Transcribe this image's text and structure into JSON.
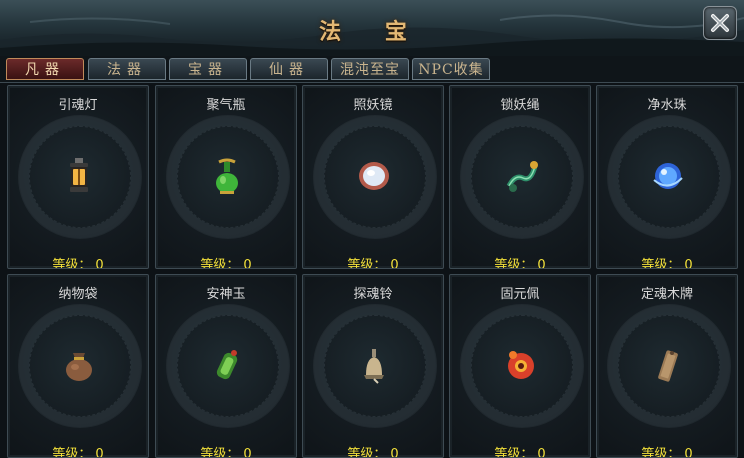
{
  "window": {
    "title": "法 宝"
  },
  "tabs": [
    {
      "label": "凡器",
      "active": true
    },
    {
      "label": "法器",
      "active": false
    },
    {
      "label": "宝器",
      "active": false
    },
    {
      "label": "仙器",
      "active": false
    },
    {
      "label": "混沌至宝",
      "active": false
    },
    {
      "label": "NPC收集",
      "active": false
    }
  ],
  "items": [
    {
      "name": "引魂灯",
      "level_label": "等级：",
      "level": "0",
      "icon": "lantern-icon"
    },
    {
      "name": "聚气瓶",
      "level_label": "等级：",
      "level": "0",
      "icon": "bottle-icon"
    },
    {
      "name": "照妖镜",
      "level_label": "等级：",
      "level": "0",
      "icon": "mirror-icon"
    },
    {
      "name": "锁妖绳",
      "level_label": "等级：",
      "level": "0",
      "icon": "rope-icon"
    },
    {
      "name": "净水珠",
      "level_label": "等级：",
      "level": "0",
      "icon": "water-pearl-icon"
    },
    {
      "name": "纳物袋",
      "level_label": "等级：",
      "level": "0",
      "icon": "pouch-icon"
    },
    {
      "name": "安神玉",
      "level_label": "等级：",
      "level": "0",
      "icon": "jade-icon"
    },
    {
      "name": "探魂铃",
      "level_label": "等级：",
      "level": "0",
      "icon": "bell-icon"
    },
    {
      "name": "固元佩",
      "level_label": "等级：",
      "level": "0",
      "icon": "pendant-icon"
    },
    {
      "name": "定魂木牌",
      "level_label": "等级：",
      "level": "0",
      "icon": "wood-tablet-icon"
    }
  ],
  "colors": {
    "title": "#e3b874",
    "level": "#f2e03a",
    "item_name": "#d9d9d9",
    "active_tab": "#6b2a2a"
  }
}
